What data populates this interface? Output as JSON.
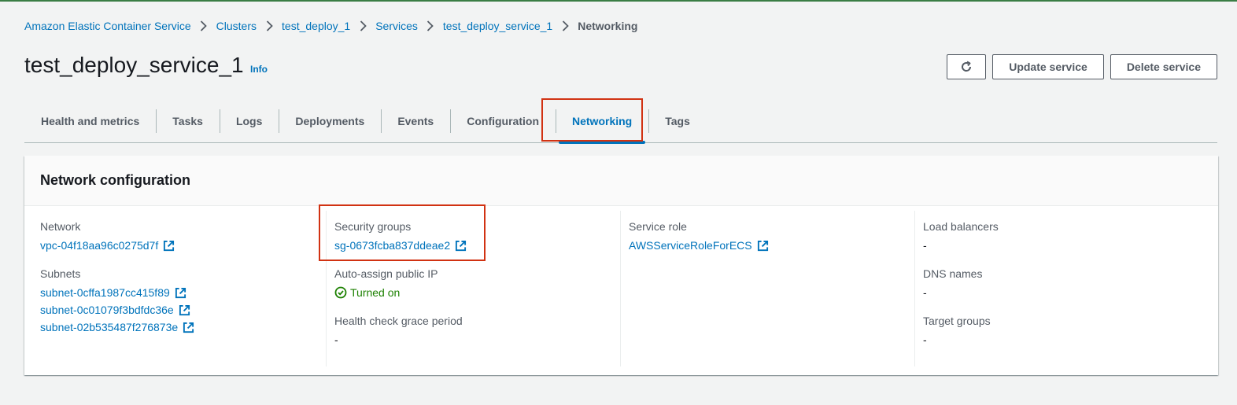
{
  "breadcrumb": {
    "items": [
      "Amazon Elastic Container Service",
      "Clusters",
      "test_deploy_1",
      "Services",
      "test_deploy_service_1"
    ],
    "current": "Networking"
  },
  "header": {
    "title": "test_deploy_service_1",
    "info_label": "Info",
    "refresh_icon": "refresh-icon",
    "update_label": "Update service",
    "delete_label": "Delete service"
  },
  "tabs": [
    {
      "label": "Health and metrics"
    },
    {
      "label": "Tasks"
    },
    {
      "label": "Logs"
    },
    {
      "label": "Deployments"
    },
    {
      "label": "Events"
    },
    {
      "label": "Configuration"
    },
    {
      "label": "Networking",
      "active": true
    },
    {
      "label": "Tags"
    }
  ],
  "panel": {
    "title": "Network configuration",
    "network": {
      "label": "Network",
      "value": "vpc-04f18aa96c0275d7f"
    },
    "subnets": {
      "label": "Subnets",
      "values": [
        "subnet-0cffa1987cc415f89",
        "subnet-0c01079f3bdfdc36e",
        "subnet-02b535487f276873e"
      ]
    },
    "security_groups": {
      "label": "Security groups",
      "value": "sg-0673fcba837ddeae2"
    },
    "auto_assign_ip": {
      "label": "Auto-assign public IP",
      "value": "Turned on"
    },
    "health_check": {
      "label": "Health check grace period",
      "value": "-"
    },
    "service_role": {
      "label": "Service role",
      "value": "AWSServiceRoleForECS"
    },
    "load_balancers": {
      "label": "Load balancers",
      "value": "-"
    },
    "dns_names": {
      "label": "DNS names",
      "value": "-"
    },
    "target_groups": {
      "label": "Target groups",
      "value": "-"
    }
  },
  "colors": {
    "link": "#0073bb",
    "success": "#1d8102",
    "highlight": "#d13212",
    "background": "#f2f3f3"
  }
}
